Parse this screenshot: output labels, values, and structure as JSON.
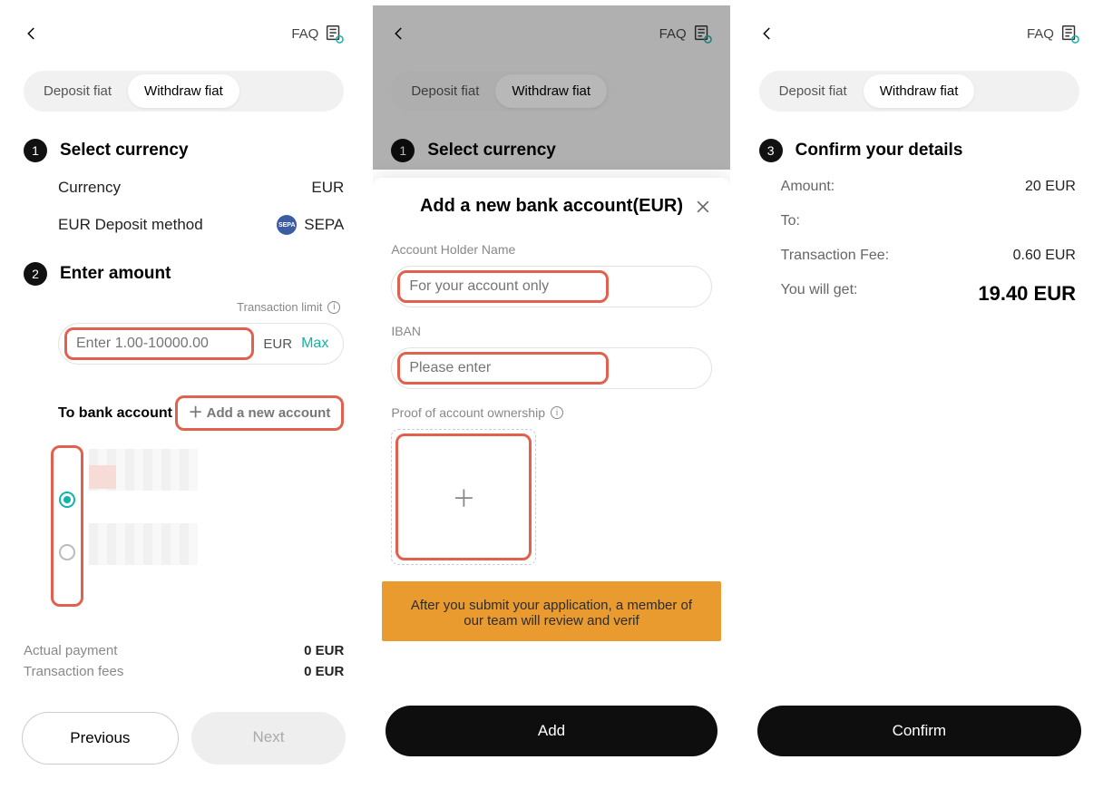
{
  "header": {
    "faq_label": "FAQ"
  },
  "tabs": {
    "deposit": "Deposit fiat",
    "withdraw": "Withdraw fiat"
  },
  "panel1": {
    "step1_num": "1",
    "step1_title": "Select currency",
    "currency_label": "Currency",
    "currency_value": "EUR",
    "method_label": "EUR Deposit method",
    "method_badge": "SEPA",
    "method_value": "SEPA",
    "step2_num": "2",
    "step2_title": "Enter amount",
    "tx_limit_label": "Transaction limit",
    "amount_placeholder": "Enter 1.00-10000.00",
    "amount_currency": "EUR",
    "max_label": "Max",
    "to_bank_label": "To bank account",
    "add_account_label": "Add a new account",
    "actual_payment_label": "Actual payment",
    "actual_payment_value": "0 EUR",
    "fees_label": "Transaction fees",
    "fees_value": "0 EUR",
    "prev_btn": "Previous",
    "next_btn": "Next"
  },
  "panel2": {
    "modal_title": "Add a new bank account(EUR)",
    "holder_label": "Account Holder Name",
    "holder_placeholder": "For your account only",
    "iban_label": "IBAN",
    "iban_placeholder": "Please enter",
    "proof_label": "Proof of account ownership",
    "notice": "After you submit your application, a member of our team will review and verif",
    "add_btn": "Add"
  },
  "panel3": {
    "step_num": "3",
    "step_title": "Confirm your details",
    "amount_label": "Amount:",
    "amount_value": "20 EUR",
    "to_label": "To:",
    "fee_label": "Transaction Fee:",
    "fee_value": "0.60 EUR",
    "get_label": "You will get:",
    "get_value": "19.40 EUR",
    "confirm_btn": "Confirm"
  }
}
